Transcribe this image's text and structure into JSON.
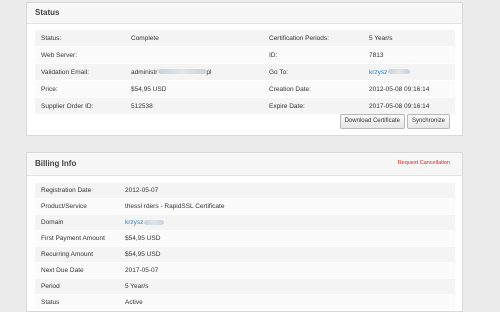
{
  "status": {
    "title": "Status",
    "rows": [
      {
        "l1": "Status:",
        "v1": "Complete",
        "l2": "Certification Periods:",
        "v2": "5 Year/s"
      },
      {
        "l1": "Web Server:",
        "v1": "",
        "l2": "ID:",
        "v2": "7813"
      },
      {
        "l1": "Validation Email:",
        "v1": "administr",
        "v1_tail": "pl",
        "l2": "Go To:",
        "v2": "krzysz"
      },
      {
        "l1": "Price:",
        "v1": "$54,95 USD",
        "l2": "Creation Date:",
        "v2": "2012-05-08 09:16:14"
      },
      {
        "l1": "Supplier Order ID:",
        "v1": "512538",
        "l2": "Expire Date:",
        "v2": "2017-05-08 09:16:14"
      }
    ],
    "buttons": {
      "download": "Download Certificate",
      "sync": "Synchronize"
    }
  },
  "billing": {
    "title": "Billing Info",
    "request_cancellation": "Request Cancellation",
    "rows": [
      {
        "label": "Registration Date",
        "value": "2012-05-07"
      },
      {
        "label": "Product/Service",
        "value": "thessl rders - RapidSSL Certificate"
      },
      {
        "label": "Domain",
        "value": "krzysz"
      },
      {
        "label": "First Payment Amount",
        "value": "$54,95 USD"
      },
      {
        "label": "Recurring Amount",
        "value": "$54,95 USD"
      },
      {
        "label": "Next Due Date",
        "value": "2017-05-07"
      },
      {
        "label": "Period",
        "value": "5 Year/s"
      },
      {
        "label": "Status",
        "value": "Active"
      }
    ]
  },
  "colors": {
    "link": "#2a7fd4",
    "cancel": "#d9261c"
  }
}
